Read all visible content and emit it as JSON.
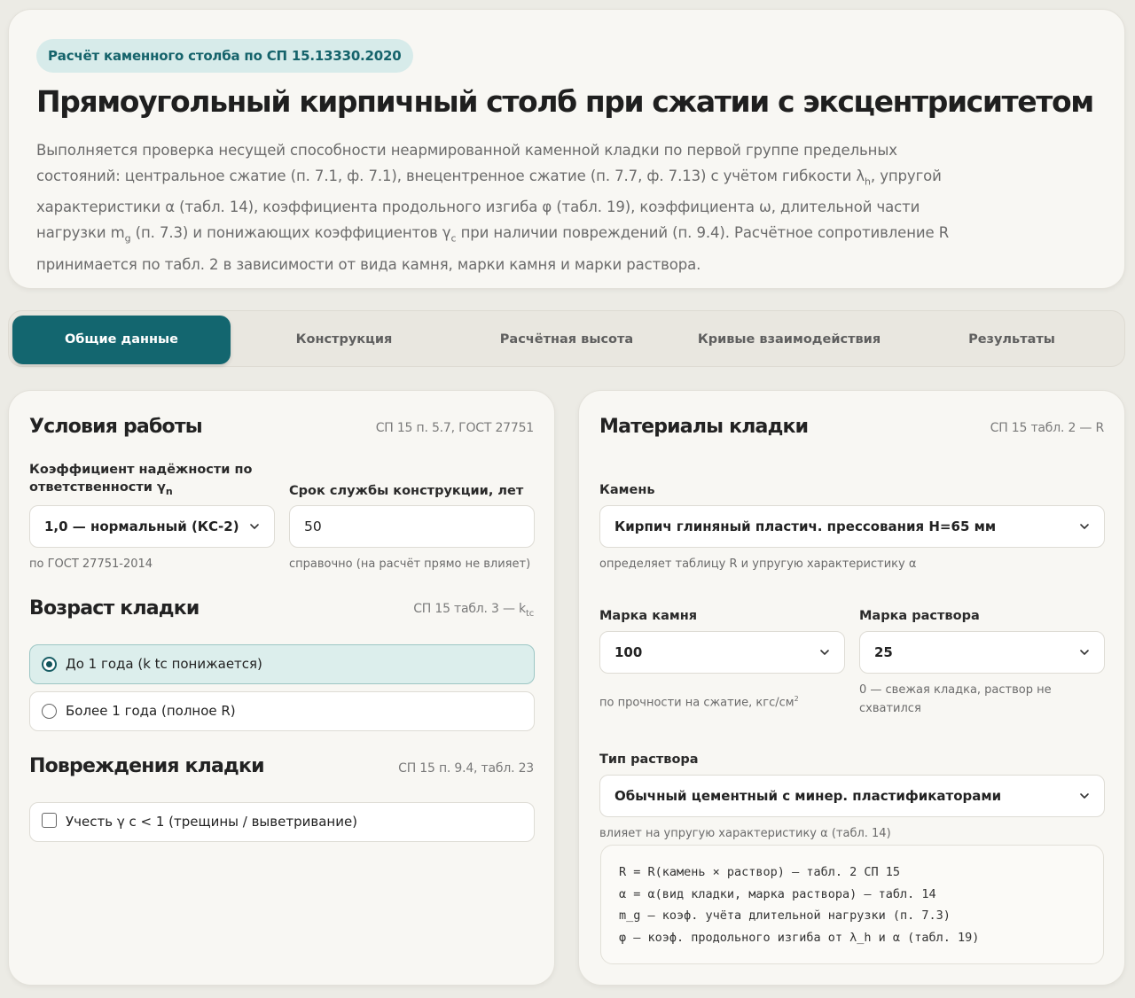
{
  "header": {
    "badge": "Расчёт каменного столба по СП 15.13330.2020",
    "title": "Прямоугольный кирпичный столб при сжатии с эксцентриситетом",
    "desc_lines": [
      "Выполняется проверка несущей способности неармированной каменной кладки по первой группе предельных",
      "состояний: центральное сжатие (п. 7.1, ф. 7.1), внецентренное сжатие (п. 7.7, ф. 7.13) с учётом гибкости λ",
      "характеристики α (табл. 14), коэффициента продольного изгиба φ (табл. 19), коэффициента ω, длительной части",
      "нагрузки m",
      "принимается по табл. 2 в зависимости от вида камня, марки камня и марки раствора."
    ],
    "desc_line2_sub": "h",
    "desc_line2_tail": ", упругой",
    "desc_line4_sub": "g",
    "desc_line4_mid": " (п. 7.3) и понижающих коэффициентов γ",
    "desc_line4_sub2": "c",
    "desc_line4_tail": " при наличии повреждений (п. 9.4). Расчётное сопротивление R"
  },
  "tabs": [
    {
      "label": "Общие данные",
      "active": true
    },
    {
      "label": "Конструкция",
      "active": false
    },
    {
      "label": "Расчётная высота",
      "active": false
    },
    {
      "label": "Кривые взаимодействия",
      "active": false
    },
    {
      "label": "Результаты",
      "active": false
    }
  ],
  "work_conditions": {
    "title": "Условия работы",
    "ref": "СП 15 п. 5.7, ГОСТ 27751",
    "reliability_label_line1": "Коэффициент надёжности по",
    "reliability_label_line2": "ответственности γ",
    "reliability_label_sub": "n",
    "reliability_value": "1,0 — нормальный (КС-2)",
    "reliability_hint": "по ГОСТ 27751-2014",
    "service_life_label": "Срок службы конструкции, лет",
    "service_life_value": "50",
    "service_life_hint": "справочно (на расчёт прямо не влияет)"
  },
  "masonry_age": {
    "title": "Возраст кладки",
    "ref": "СП 15 табл. 3 — k",
    "ref_sub": "tc",
    "options": [
      {
        "label": "До 1 года (k  tc  понижается)",
        "checked": true
      },
      {
        "label": "Более 1 года (полное R)",
        "checked": false
      }
    ]
  },
  "damage": {
    "title": "Повреждения кладки",
    "ref": "СП 15 п. 9.4, табл. 23",
    "checkbox_label": "Учесть γ  c  < 1 (трещины / выветривание)",
    "checked": false
  },
  "materials": {
    "title": "Материалы кладки",
    "ref": "СП 15 табл. 2 — R",
    "stone_label": "Камень",
    "stone_value": "Кирпич глиняный пластич. прессования H=65 мм",
    "stone_hint": "определяет таблицу R и упругую характеристику α",
    "stone_grade_label": "Марка камня",
    "stone_grade_value": "100",
    "stone_grade_hint": "по прочности на сжатие, кгс/см",
    "stone_grade_hint_sup": "2",
    "mortar_grade_label": "Марка раствора",
    "mortar_grade_value": "25",
    "mortar_grade_hint_line1": "0 — свежая кладка, раствор не",
    "mortar_grade_hint_line2": "схватился",
    "mortar_type_label": "Тип раствора",
    "mortar_type_value": "Обычный цементный с минер. пластификаторами",
    "mortar_type_hint": "влияет на упругую характеристику α (табл. 14)",
    "code_lines": [
      "R = R(камень × раствор) — табл. 2 СП 15",
      "α = α(вид кладки, марка раствора) — табл. 14",
      "m_g — коэф. учёта длительной нагрузки (п. 7.3)",
      "φ — коэф. продольного изгиба от λ_h и α (табл. 19)"
    ]
  },
  "colors": {
    "accent": "#13666f",
    "badge_bg": "#d7ebea",
    "page_bg": "#ecebe5",
    "card_bg": "#f8f7f3",
    "selected_radio_bg": "#dceeec"
  }
}
